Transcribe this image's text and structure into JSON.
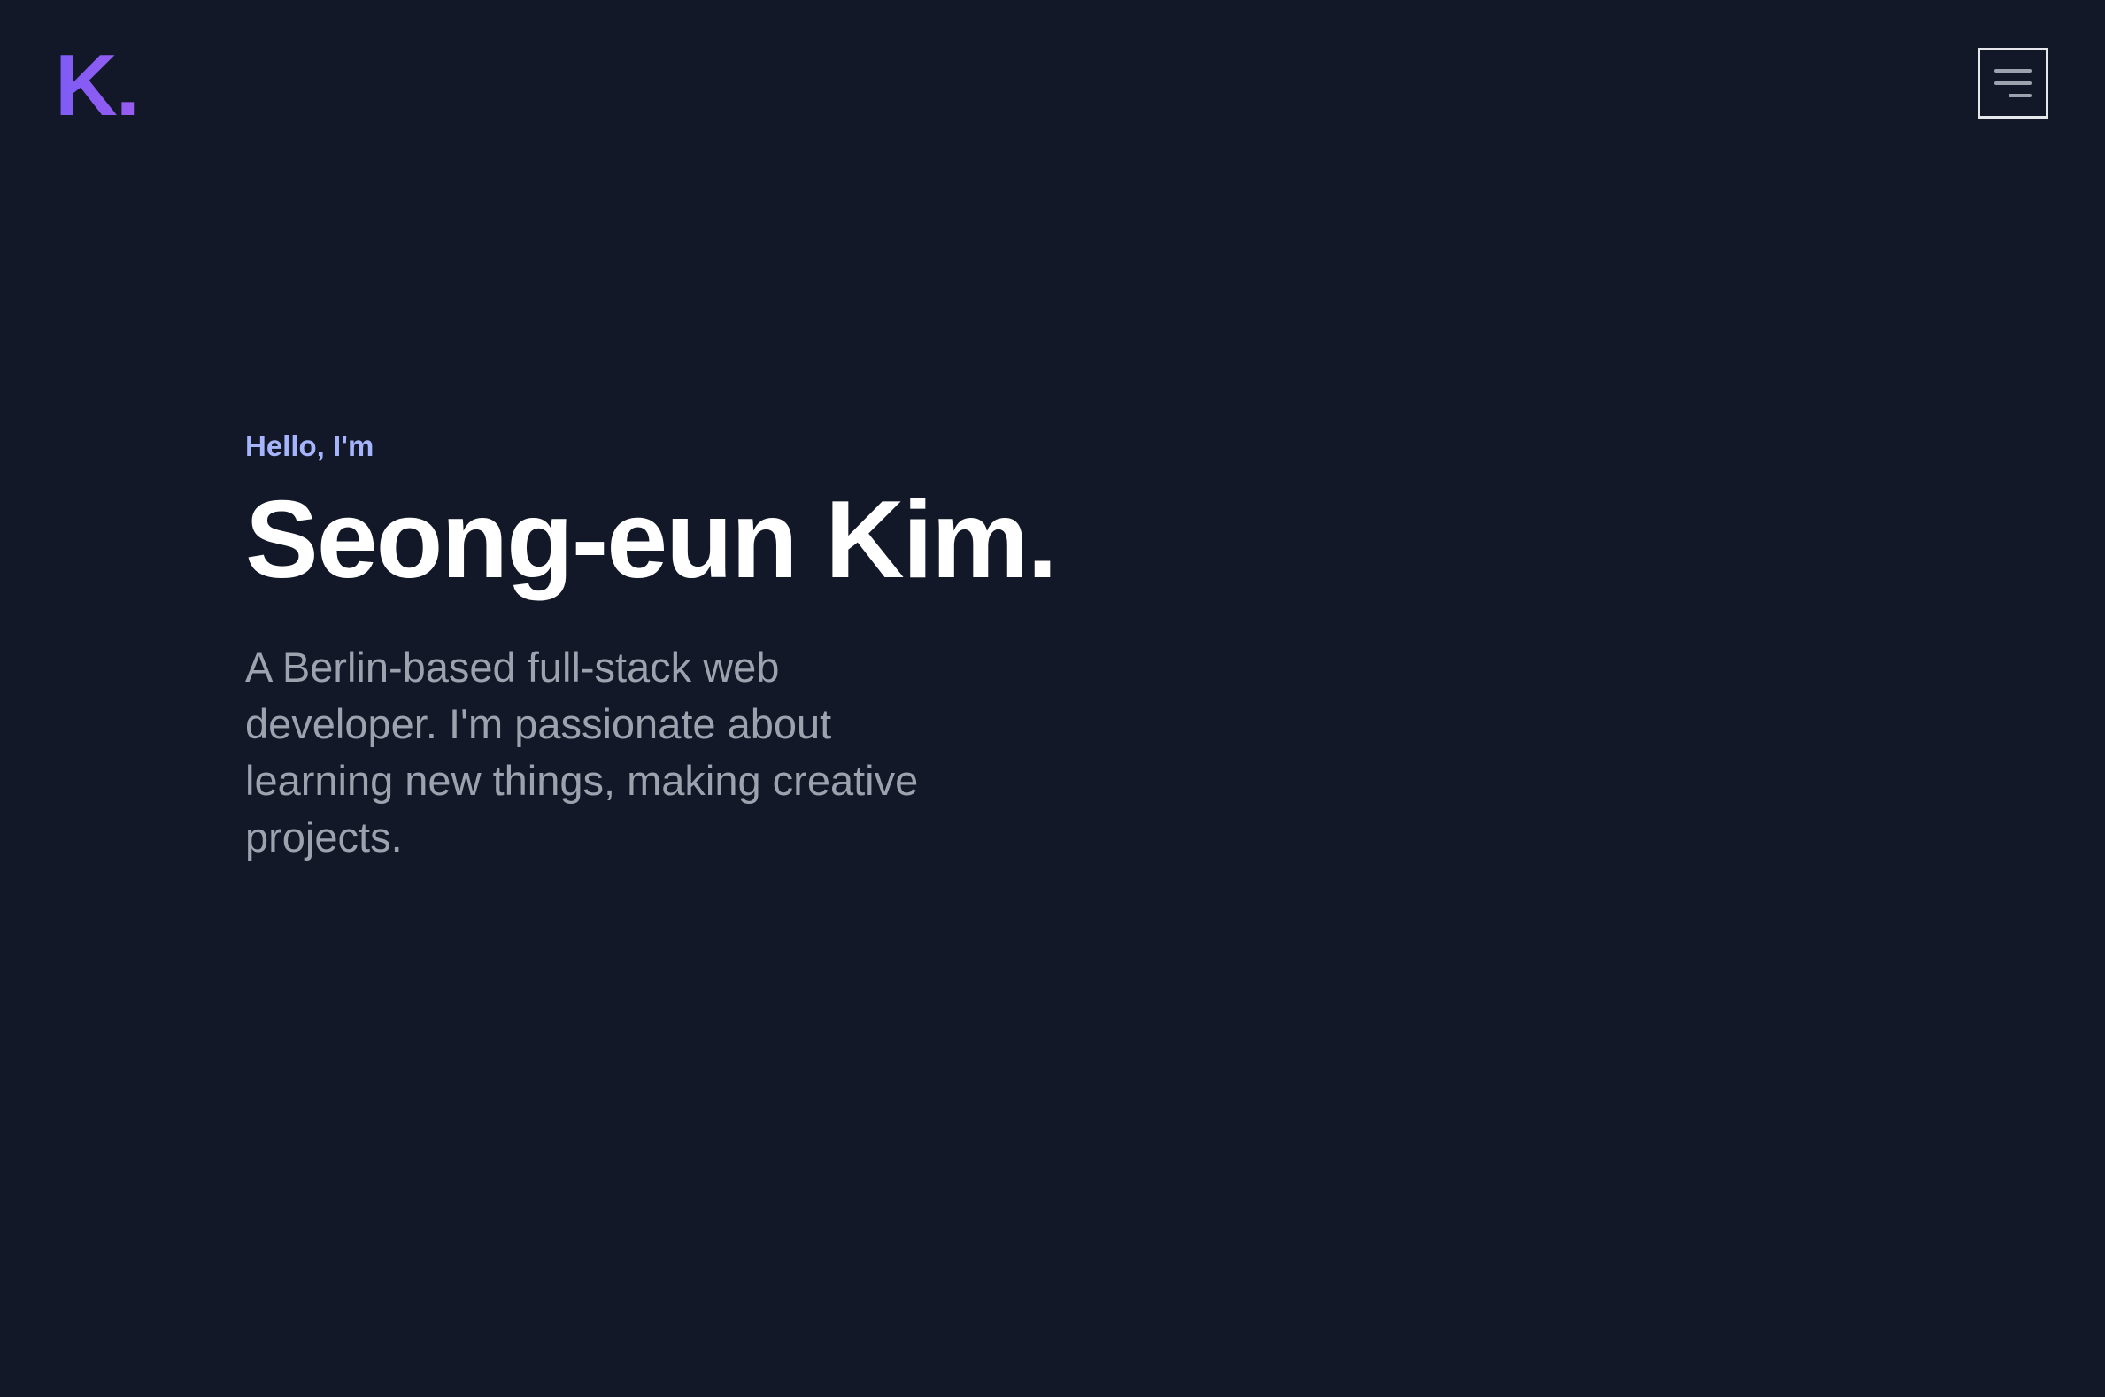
{
  "header": {
    "logo_text": "K.",
    "menu_icon": "hamburger-menu-icon"
  },
  "hero": {
    "greeting": "Hello, I'm",
    "name": "Seong-eun Kim.",
    "bio": "A Berlin-based full-stack web developer. I'm passionate about learning new things, making creative projects."
  },
  "colors": {
    "background": "#121827",
    "logo_accent": "#8b5cf6",
    "greeting": "#a5b4fc",
    "heading": "#ffffff",
    "body_text": "#9ca3af",
    "menu_border": "#e5e7eb"
  }
}
